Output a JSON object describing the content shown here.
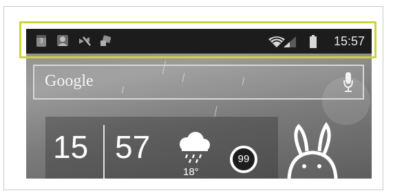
{
  "status_bar": {
    "time": "15:57",
    "calendar_day": "3",
    "notification_icons": [
      "calendar-icon",
      "avatar-notification-icon",
      "mute-icon",
      "chat-icon"
    ],
    "system_icons": [
      "wifi-icon",
      "signal-icon",
      "battery-icon"
    ],
    "highlight_color": "#cdd438"
  },
  "search": {
    "label": "Google",
    "icon": "mic-icon"
  },
  "clock_widget": {
    "hour": "15",
    "minute": "57",
    "temperature": "18°",
    "weather_icon": "rain-cloud-icon",
    "battery_level": "99"
  }
}
